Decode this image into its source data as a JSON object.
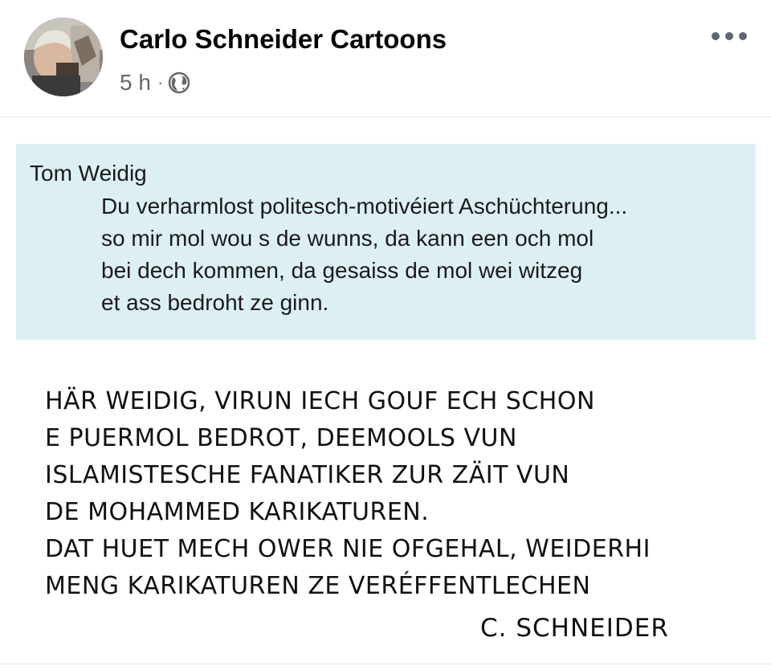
{
  "post": {
    "author": "Carlo Schneider Cartoons",
    "time": "5 h",
    "separator": "·",
    "audience_icon": "globe-icon",
    "more_icon": "more-options-icon"
  },
  "image": {
    "quote": {
      "author": "Tom Weidig",
      "lines": [
        "Du verharmlost politesch-motivéiert Aschüchterung...",
        "so mir mol wou s de wunns, da kann een och mol",
        "bei dech kommen, da gesaiss de mol wei witzeg",
        "et ass bedroht ze ginn."
      ]
    },
    "reply_lines": [
      "HÄR WEIDIG, VIRUN IECH GOUF ECH SCHON",
      "E PUERMOL BEDROT, DEEMOOLS VUN",
      "ISLAMISTESCHE FANATIKER ZUR ZÄIT VUN",
      "DE MOHAMMED KARIKATUREN.",
      "DAT HUET MECH OWER NIE OFGEHAL, WEIDERHI",
      "MENG KARIKATUREN ZE VERÉFFENTLECHEN"
    ],
    "signature": "C. SCHNEIDER"
  },
  "colors": {
    "quote_background": "#dcf0f4",
    "secondary_text": "#65676b"
  }
}
